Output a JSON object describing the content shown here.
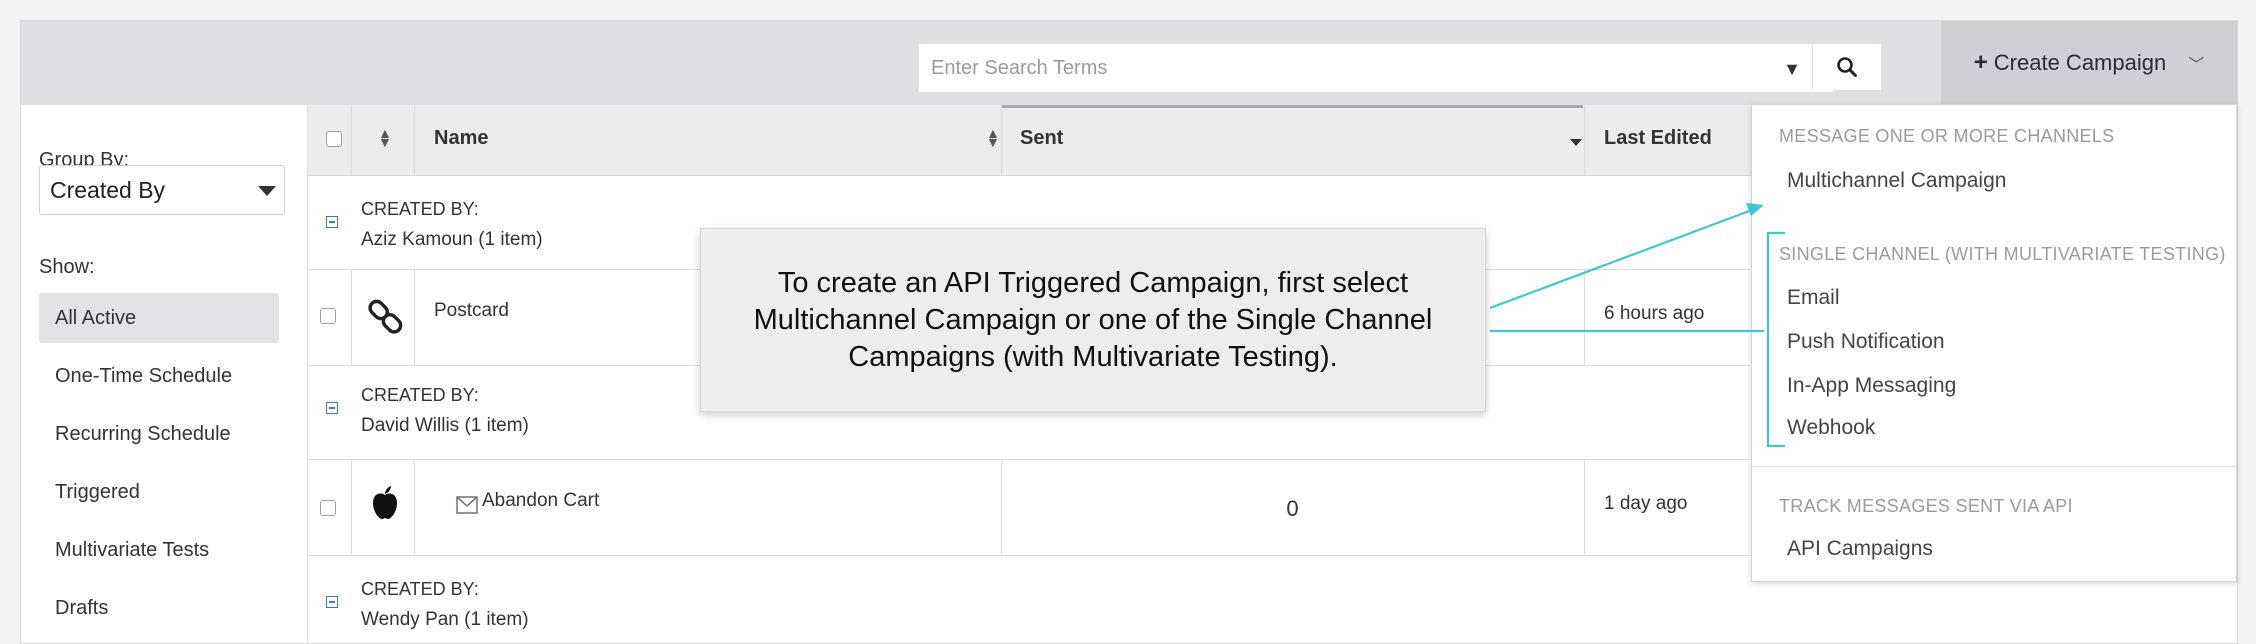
{
  "search": {
    "placeholder": "Enter Search Terms"
  },
  "create_button": {
    "label": "Create Campaign"
  },
  "sidebar": {
    "group_by_label": "Group By:",
    "group_by_value": "Created By",
    "show_label": "Show:",
    "items": [
      {
        "label": "All Active",
        "active": true
      },
      {
        "label": "One-Time Schedule"
      },
      {
        "label": "Recurring Schedule"
      },
      {
        "label": "Triggered"
      },
      {
        "label": "Multivariate Tests"
      },
      {
        "label": "Drafts"
      }
    ]
  },
  "table": {
    "headers": {
      "name": "Name",
      "sent": "Sent",
      "last_edited": "Last Edited"
    },
    "groups": [
      {
        "title": "CREATED BY:",
        "owner": "Aziz Kamoun (1 item)"
      },
      {
        "title": "CREATED BY:",
        "owner": "David Willis (1 item)"
      },
      {
        "title": "CREATED BY:",
        "owner": "Wendy Pan (1 item)"
      }
    ],
    "rows": [
      {
        "icon": "link-icon",
        "name": "Postcard",
        "sent": "",
        "last_edited": "6 hours ago"
      },
      {
        "icon": "apple-icon",
        "name": "Abandon Cart",
        "sent": "0",
        "last_edited": "1 day ago"
      }
    ]
  },
  "menu": {
    "section1_heading": "MESSAGE ONE OR MORE CHANNELS",
    "section1_items": [
      "Multichannel Campaign"
    ],
    "section2_heading": "SINGLE CHANNEL (WITH MULTIVARIATE TESTING)",
    "section2_items": [
      "Email",
      "Push Notification",
      "In-App Messaging",
      "Webhook"
    ],
    "section3_heading": "TRACK MESSAGES SENT VIA API",
    "section3_items": [
      "API Campaigns"
    ]
  },
  "callout": {
    "text": "To create an API Triggered Campaign, first select Multichannel Campaign or one of the Single Channel Campaigns (with Multivariate Testing)."
  },
  "colors": {
    "accent_line": "#3fc6d4",
    "link": "#2c3e8f",
    "topbar": "#dfdfe4"
  }
}
